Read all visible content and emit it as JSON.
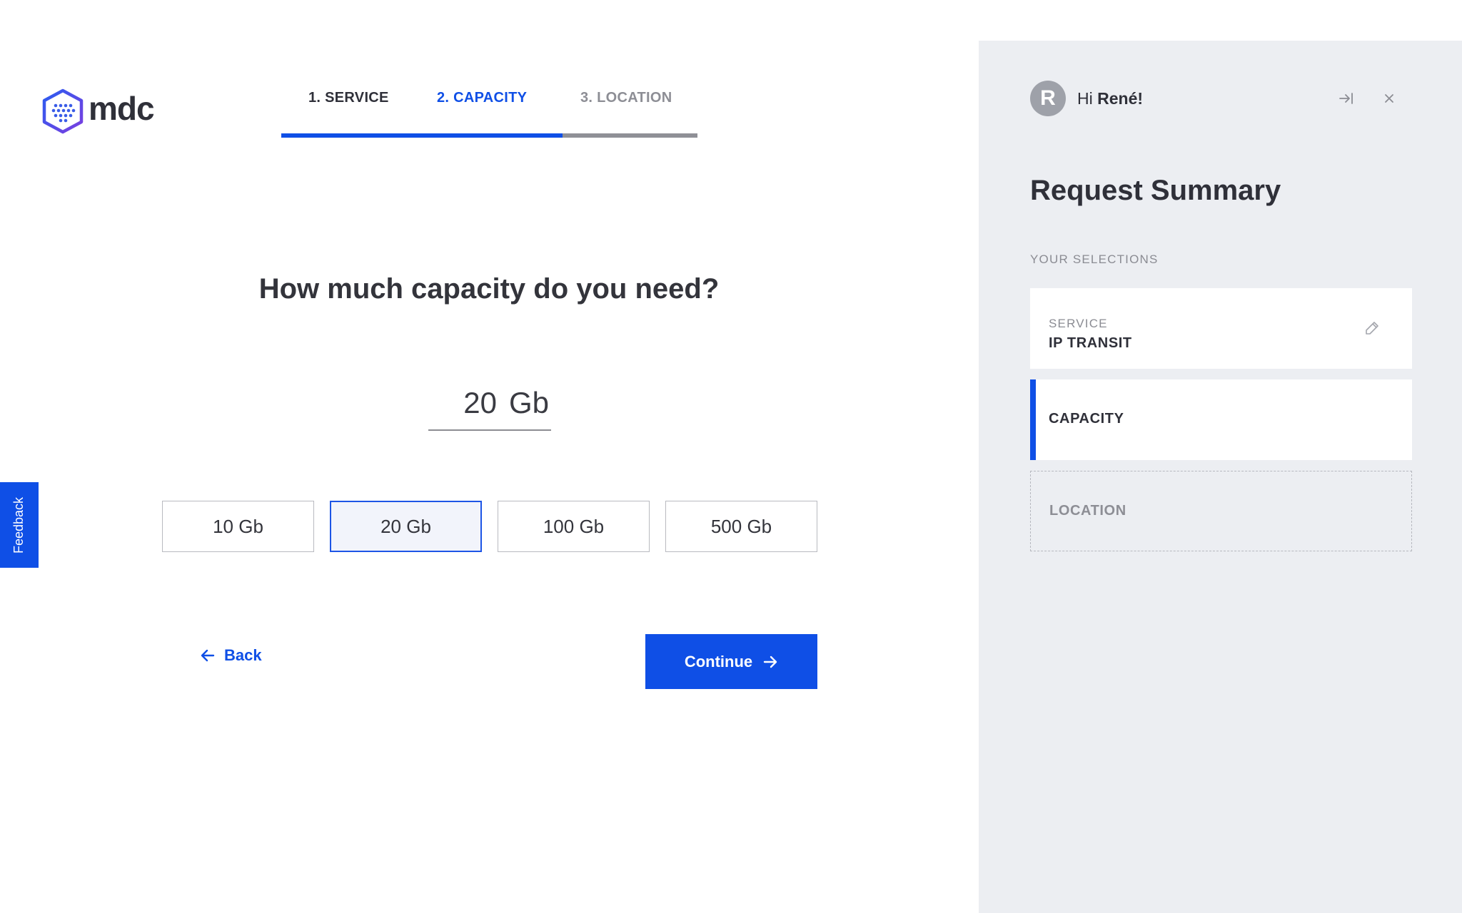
{
  "brand": {
    "name": "mdc",
    "accent": "#0f4fe6"
  },
  "steps": [
    {
      "label": "1. SERVICE",
      "state": "done"
    },
    {
      "label": "2. CAPACITY",
      "state": "active"
    },
    {
      "label": "3. LOCATION",
      "state": "pending"
    }
  ],
  "progress": {
    "fraction": 0.675
  },
  "question": "How much capacity do you need?",
  "capacity": {
    "value": "20",
    "unit": "Gb"
  },
  "options": [
    {
      "label": "10 Gb",
      "selected": false
    },
    {
      "label": "20 Gb",
      "selected": true
    },
    {
      "label": "100 Gb",
      "selected": false
    },
    {
      "label": "500 Gb",
      "selected": false
    }
  ],
  "nav": {
    "back_label": "Back",
    "continue_label": "Continue"
  },
  "feedback_label": "Feedback",
  "panel": {
    "avatar_initial": "R",
    "greeting_prefix": "Hi",
    "user_name": "René!",
    "title": "Request Summary",
    "selections_label": "YOUR SELECTIONS",
    "cards": {
      "service": {
        "label": "SERVICE",
        "value": "IP TRANSIT"
      },
      "capacity": {
        "label": "CAPACITY"
      },
      "location": {
        "label": "LOCATION"
      }
    }
  },
  "icons": {
    "logo": "hexagon-dots-icon",
    "collapse": "collapse-panel-icon",
    "close": "close-icon",
    "edit": "pencil-icon",
    "back": "arrow-left-icon",
    "continue": "arrow-right-icon"
  }
}
